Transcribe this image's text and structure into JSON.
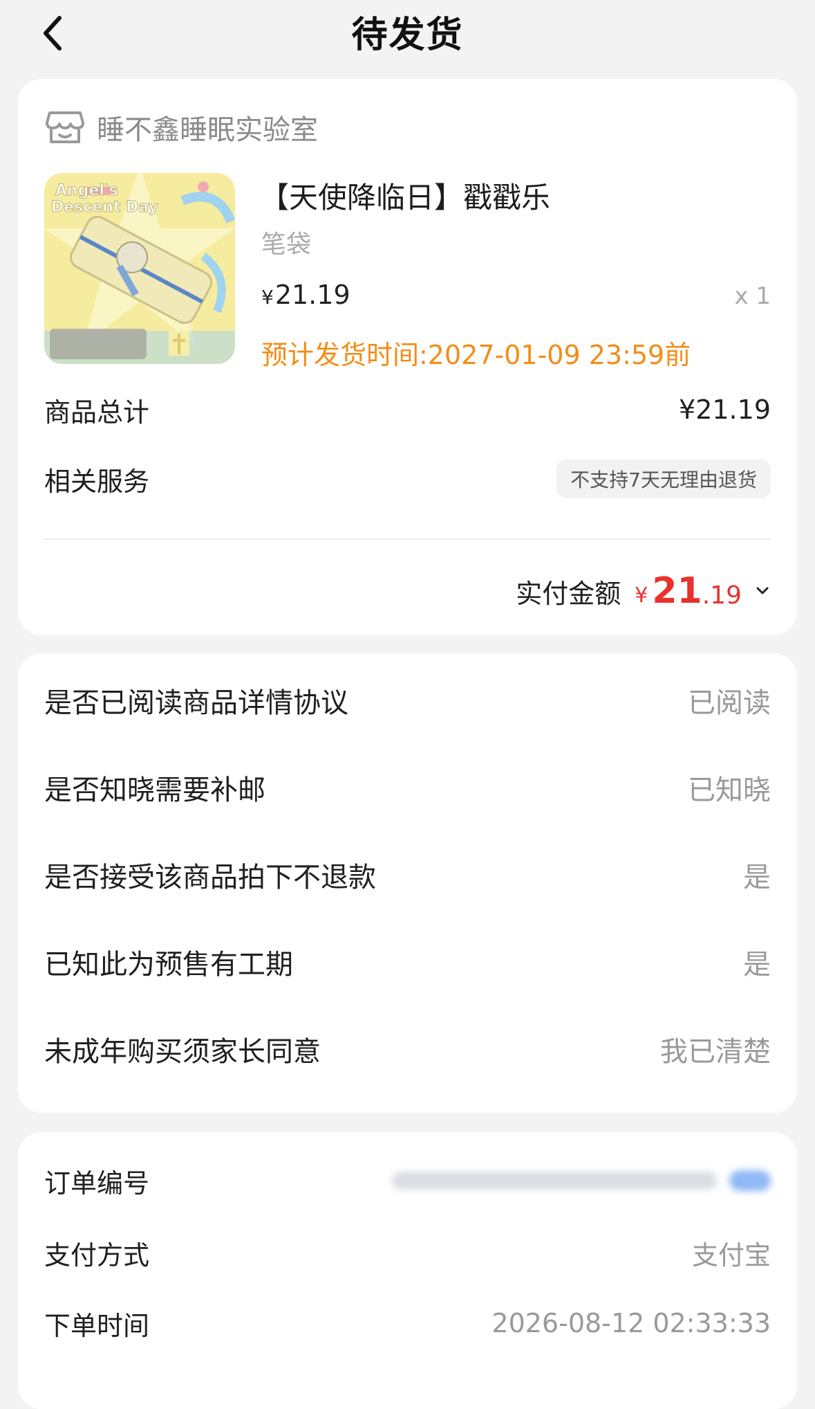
{
  "header": {
    "title": "待发货"
  },
  "shop": {
    "name": "睡不鑫睡眠实验室"
  },
  "product": {
    "image_text_1": "Angel's",
    "image_text_2": "Descent Day",
    "name": "【天使降临日】戳戳乐",
    "spec": "笔袋",
    "currency": "¥",
    "price": "21.19",
    "quantity": "x 1",
    "ship_time": "预计发货时间:2027-01-09 23:59前"
  },
  "summary": {
    "total_label": "商品总计",
    "total_value": "¥21.19",
    "service_label": "相关服务",
    "service_tag": "不支持7天无理由退货",
    "paid_label": "实付金额",
    "paid_currency": "¥",
    "paid_int": "21",
    "paid_dec": ".19"
  },
  "questions": [
    {
      "label": "是否已阅读商品详情协议",
      "value": "已阅读"
    },
    {
      "label": "是否知晓需要补邮",
      "value": "已知晓"
    },
    {
      "label": "是否接受该商品拍下不退款",
      "value": "是"
    },
    {
      "label": "已知此为预售有工期",
      "value": "是"
    },
    {
      "label": "未成年购买须家长同意",
      "value": "我已清楚"
    }
  ],
  "order": {
    "number_label": "订单编号",
    "payment_label": "支付方式",
    "payment_value": "支付宝",
    "time_label": "下单时间",
    "time_value": "2026-08-12 02:33:33"
  },
  "colors": {
    "accent_orange": "#f28d16",
    "price_red": "#e8312d",
    "background": "#f3f3f3"
  }
}
